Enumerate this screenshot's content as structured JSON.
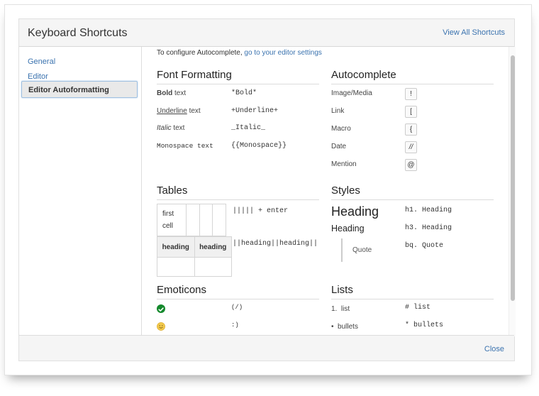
{
  "dialog": {
    "title": "Keyboard Shortcuts",
    "view_all_label": "View All Shortcuts",
    "close_label": "Close"
  },
  "sidebar": {
    "items": [
      {
        "label": "General",
        "selected": false
      },
      {
        "label": "Editor",
        "selected": false
      },
      {
        "label": "Editor Autoformatting",
        "selected": true
      }
    ]
  },
  "content": {
    "config_text": "To configure Autocomplete, ",
    "config_link": "go to your editor settings",
    "font_formatting": {
      "title": "Font Formatting",
      "rows": [
        {
          "label_styled": "Bold",
          "label_rest": " text",
          "markup": "*Bold*"
        },
        {
          "label_styled": "Underline",
          "label_rest": " text",
          "markup": "+Underline+"
        },
        {
          "label_styled": "Italic",
          "label_rest": " text",
          "markup": "_Italic_"
        },
        {
          "label_styled": "Monospace text",
          "label_rest": "",
          "markup": "{{Monospace}}"
        }
      ]
    },
    "autocomplete": {
      "title": "Autocomplete",
      "rows": [
        {
          "label": "Image/Media",
          "key": "!"
        },
        {
          "label": "Link",
          "key": "["
        },
        {
          "label": "Macro",
          "key": "{"
        },
        {
          "label": "Date",
          "key": "//"
        },
        {
          "label": "Mention",
          "key": "@"
        }
      ]
    },
    "tables": {
      "title": "Tables",
      "example1_cell": "first cell",
      "example1_cell_line1": "first",
      "example1_cell_line2": "cell",
      "markup1": "||||| + enter",
      "headings": [
        "heading",
        "heading"
      ],
      "markup2": "||heading||heading||"
    },
    "styles": {
      "title": "Styles",
      "h1_label": "Heading",
      "h1_markup": "h1. Heading",
      "h3_label": "Heading",
      "h3_markup": "h3. Heading",
      "quote_label": "Quote",
      "quote_markup": "bq. Quote"
    },
    "emoticons": {
      "title": "Emoticons",
      "rows": [
        {
          "icon": "check-icon",
          "markup": "(/)"
        },
        {
          "icon": "smile-icon",
          "markup": ":)"
        }
      ]
    },
    "lists": {
      "title": "Lists",
      "rows": [
        {
          "label": "1.  list",
          "markup": "# list"
        },
        {
          "label": "•  bullets",
          "markup": "* bullets"
        }
      ]
    }
  },
  "colors": {
    "link": "#3b73af",
    "check_green": "#14892c",
    "smile_yellow": "#f2c94c"
  }
}
